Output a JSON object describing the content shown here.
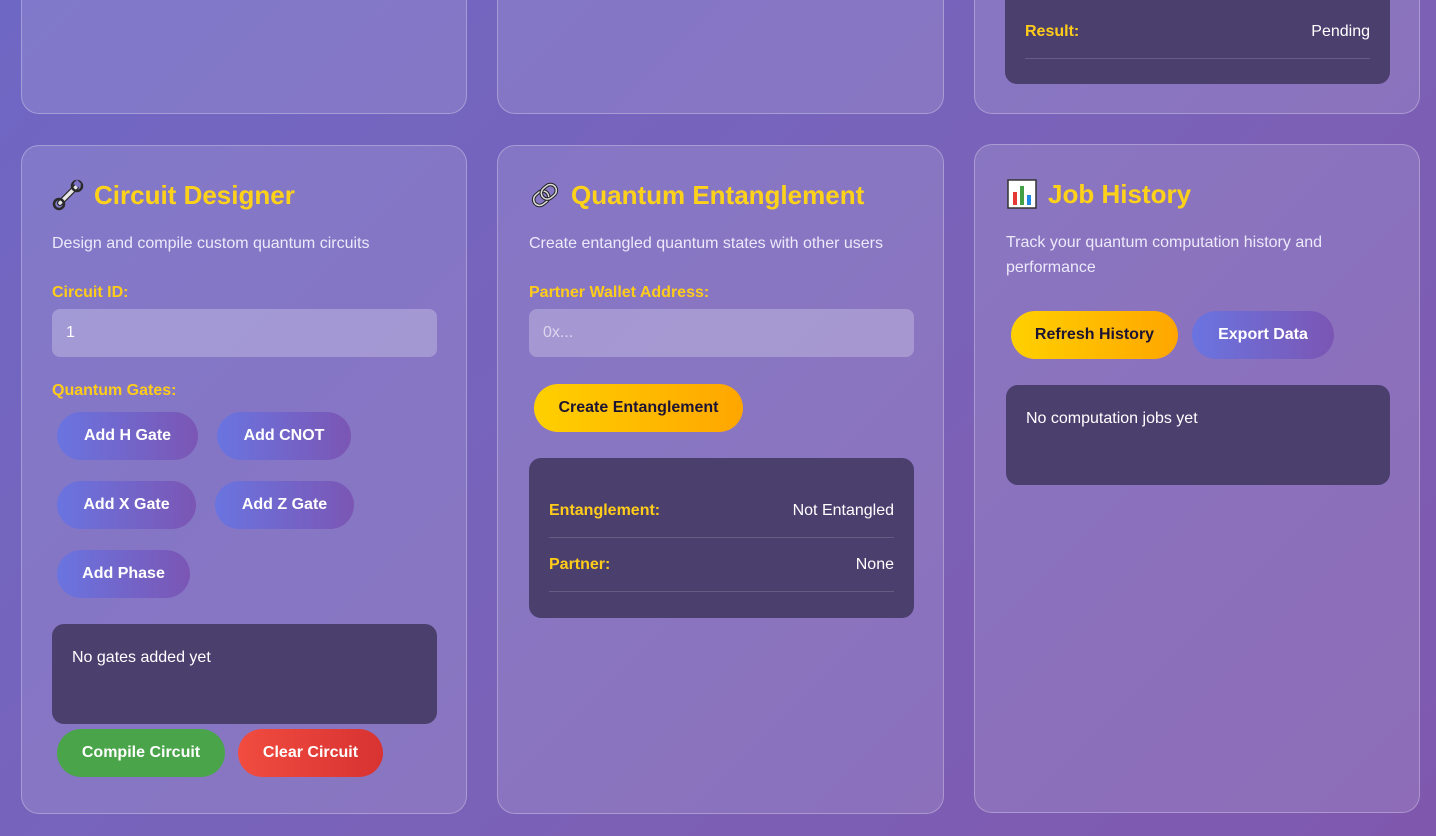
{
  "top_right_panel": {
    "result_label": "Result:",
    "result_value": "Pending"
  },
  "circuit_designer": {
    "title": "Circuit Designer",
    "description": "Design and compile custom quantum circuits",
    "circuit_id_label": "Circuit ID:",
    "circuit_id_value": "1",
    "gates_label": "Quantum Gates:",
    "gate_buttons": {
      "h": "Add H Gate",
      "cnot": "Add CNOT",
      "x": "Add X Gate",
      "z": "Add Z Gate",
      "phase": "Add Phase"
    },
    "gates_empty": "No gates added yet",
    "compile_label": "Compile Circuit",
    "clear_label": "Clear Circuit",
    "icon": "wrench-icon"
  },
  "entanglement": {
    "title": "Quantum Entanglement",
    "description": "Create entangled quantum states with other users",
    "partner_label": "Partner Wallet Address:",
    "partner_placeholder": "0x...",
    "create_label": "Create Entanglement",
    "status_label": "Entanglement:",
    "status_value": "Not Entangled",
    "partner_row_label": "Partner:",
    "partner_row_value": "None",
    "icon": "link-icon"
  },
  "job_history": {
    "title": "Job History",
    "description": "Track your quantum computation history and performance",
    "refresh_label": "Refresh History",
    "export_label": "Export Data",
    "empty_text": "No computation jobs yet",
    "icon": "bar-chart-icon"
  },
  "colors": {
    "accent_yellow": "#ffd21a",
    "panel_bg": "#4b3f6e",
    "gate_gradient_start": "#6a74e0",
    "gate_gradient_end": "#7b56b4",
    "compile_green": "#4aa54a",
    "clear_red": "#e63c36"
  }
}
